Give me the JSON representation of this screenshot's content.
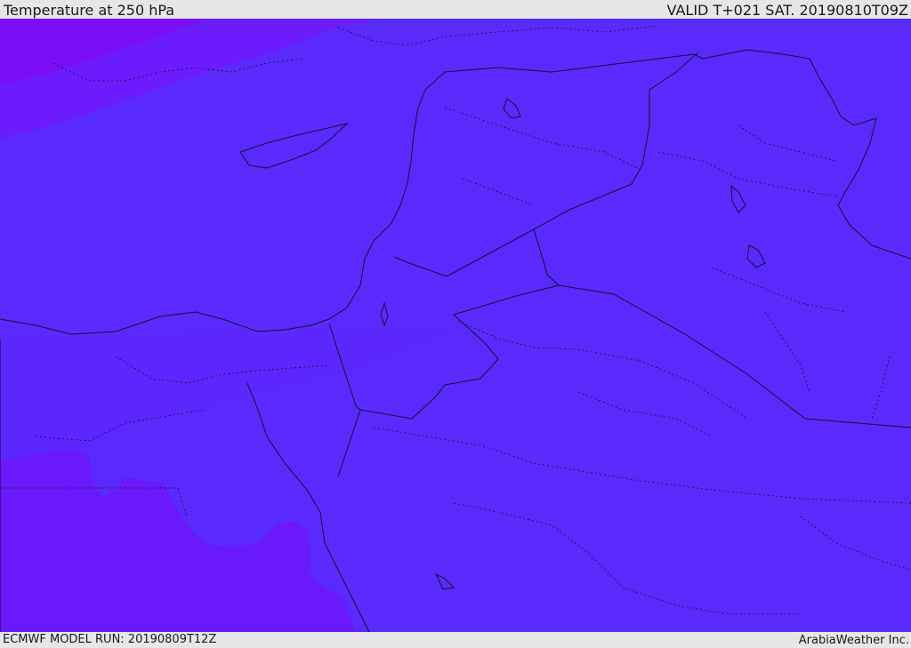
{
  "header": {
    "title": "Temperature at 250 hPa",
    "valid_time": "VALID T+021 SAT. 20190810T09Z"
  },
  "footer": {
    "model_run": "ECMWF MODEL RUN: 20190809T12Z",
    "credit": "ArabiaWeather Inc."
  },
  "colors": {
    "base_field": "#5a2afc",
    "cold_band": "#6919fc",
    "coldest_band": "#7c0df7",
    "mid_band": "#5f25fc",
    "border": "#111133",
    "background": "#e6e6e6"
  }
}
